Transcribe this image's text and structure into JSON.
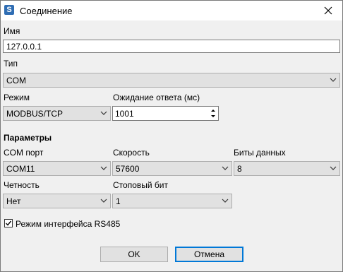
{
  "window": {
    "title": "Соединение",
    "close_symbol": "✕"
  },
  "name": {
    "label": "Имя",
    "value": "127.0.0.1"
  },
  "type": {
    "label": "Тип",
    "value": "COM"
  },
  "mode": {
    "label": "Режим",
    "value": "MODBUS/TCP"
  },
  "timeout": {
    "label": "Ожидание ответа (мс)",
    "value": "1001"
  },
  "params": {
    "heading": "Параметры",
    "com_port": {
      "label": "COM порт",
      "value": "COM11"
    },
    "speed": {
      "label": "Скорость",
      "value": "57600"
    },
    "data_bits": {
      "label": "Биты данных",
      "value": "8"
    },
    "parity": {
      "label": "Четность",
      "value": "Нет"
    },
    "stop_bits": {
      "label": "Стоповый бит",
      "value": "1"
    }
  },
  "rs485": {
    "label": "Режим интерфейса RS485",
    "checked": true
  },
  "buttons": {
    "ok": "OK",
    "cancel": "Отмена"
  },
  "colors": {
    "accent": "#0078d7",
    "icon": "#2f6db3"
  }
}
